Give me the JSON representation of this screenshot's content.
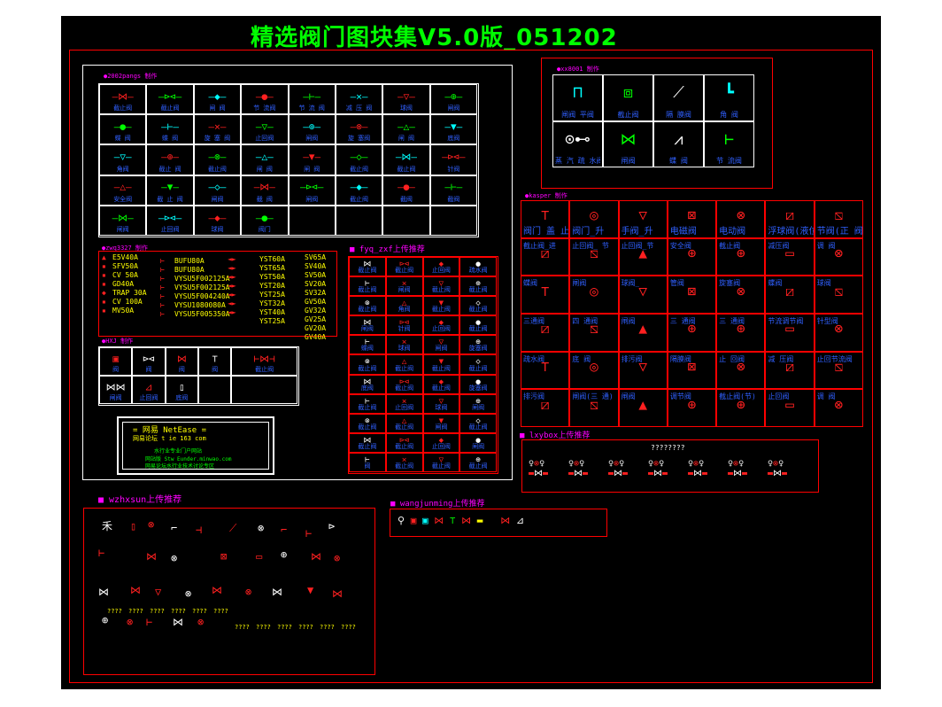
{
  "title": "精选阀门图块集V5.0版_051202",
  "colors": {
    "background": "#000000",
    "frame": "#ff0000",
    "title": "#00ff00",
    "label": "#ff00ff",
    "caption": "#3060ff"
  },
  "sections": {
    "s2002": {
      "label": "●2002pangs 制作"
    },
    "sxx": {
      "label": "●xx8001 制作"
    },
    "skasper": {
      "label": "●kasper 制作"
    },
    "szwq": {
      "label": "●zwq3327 制作"
    },
    "shxj": {
      "label": "●HXJ 制作"
    },
    "sfyq": {
      "label": "■ fyq_zxf上传推荐"
    },
    "slxy": {
      "label": "■ lxybox上传推荐",
      "heading": "????????"
    },
    "swzh": {
      "label": "■ wzhxsun上传推荐"
    },
    "swang": {
      "label": "■ wangjunming上传推荐"
    }
  },
  "netbase": {
    "line1": "= 网易 NetEase =",
    "line2": "网易论坛 t  ie 163 com",
    "line3": "水行业专业门户网站",
    "line4": "网站版 Stw Eunder.minwao.com",
    "line5": "网易论坛水行业技术讨论专区"
  },
  "zwq_items": {
    "col1": [
      "E5V40A",
      "SFV50A",
      "CV 50A",
      "GD40A",
      "TRAP 30A",
      "CV 100A",
      "MV50A"
    ],
    "col2": [
      "BUFU80A",
      "BUFU80A",
      "VYSU5F002125A",
      "VYSU5F002125A",
      "VYSU5F004240A",
      "VYSU1080080A",
      "VYSU5F005350A"
    ],
    "col3": [
      "YST60A",
      "YST65A",
      "YST50A",
      "YST20A",
      "YST25A",
      "YST32A",
      "YST40A",
      "YST25A"
    ],
    "col4": [
      "SV65A",
      "SV40A",
      "SV50A",
      "SV20A",
      "SV32A",
      "GV50A",
      "GV32A",
      "GV25A",
      "GV20A",
      "GV40A"
    ]
  },
  "xx_cells": [
    "闸阀 平阀",
    "截止阀",
    "隔 膜阀",
    "角 阀",
    "蒸 汽 疏 水阀",
    "闸阀",
    "蝶 阀",
    "节 流阀"
  ],
  "kasper_cells": [
    "阀门 盖 止",
    "阀门_升",
    "手阀_升",
    "电磁阀",
    "电动阀",
    "浮球阀(液位)",
    "节阀(正 阀)",
    "截止阀_进",
    "止回阀_ 节",
    "止回阀_节",
    "安全阀",
    "截止阀",
    "减压阀",
    "调 阀",
    "蝶阀",
    "闸阀",
    "球阀_",
    "管阀",
    "旋塞阀",
    "蝶阀",
    "球阀",
    "三通阀",
    "四 通阀",
    "闸阀",
    "三 通阀",
    "三 通阀",
    "节流调节阀",
    "针型阀",
    "疏水阀",
    "底 阀",
    "排污阀",
    "隔膜阀",
    "止 回阀",
    "减 压阀",
    "止回节流阀",
    "排污阀",
    "闸阀(三 通)",
    "闸阀",
    "调节阀",
    "截止阀(节)",
    "止回阀",
    "调 阀"
  ],
  "s2002_rows": [
    [
      "截止阀",
      "截止阀",
      "闸 阀",
      "节 流阀",
      "节 流 阀",
      "减 压 阀",
      "球阀",
      "闸阀"
    ],
    [
      "蝶 阀",
      "蝶 阀",
      "旋 塞 阀",
      "止回阀",
      "闸阀",
      "旋 塞阀",
      "闸 阀",
      "底阀"
    ],
    [
      "角阀",
      "截止 阀",
      "截止阀",
      "闸 阀",
      "闸 阀",
      "截止阀",
      "截止阀",
      "针阀"
    ],
    [
      "安全阀",
      "截 止 阀",
      "闸阀",
      "截 阀",
      "闸阀",
      "截止阀",
      "截阀",
      "截阀"
    ],
    [
      "闸阀",
      "止回阀",
      "球阀",
      "阀门",
      "",
      "",
      "",
      ""
    ]
  ],
  "fyq_cells": [
    "截止阀",
    "截止阀",
    "止回阀",
    "疏水阀",
    "截止阀",
    "闸阀",
    "截止阀",
    "截止阀",
    "截止阀",
    "角阀",
    "截止阀",
    "截止阀",
    "闸阀",
    "针阀",
    "止回阀",
    "截止阀",
    "蝶阀",
    "球阀",
    "闸阀",
    "旋塞阀",
    "截止阀",
    "截止阀",
    "截止阀",
    "截止阀",
    "底阀",
    "截止阀",
    "截止阀",
    "旋塞阀",
    "截止阀",
    "止回阀",
    "球阀",
    "闸阀",
    "截止阀",
    "截止阀",
    "闸阀",
    "截止阀",
    "截止阀",
    "截止阀",
    "止回阀",
    "闸阀",
    "阀",
    "截止阀",
    "截止阀",
    "截止阀"
  ],
  "hxj_cells": [
    "阀",
    "阀",
    "阀",
    "阀",
    "截止阀",
    "闸阀",
    "止回阀",
    "底阀"
  ],
  "wzh_caption": "????"
}
